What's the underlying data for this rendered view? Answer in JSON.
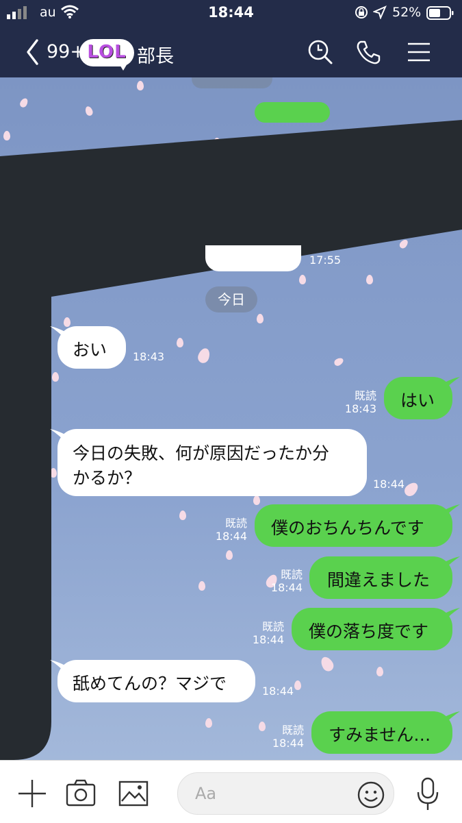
{
  "status_bar": {
    "carrier": "au",
    "time": "18:44",
    "battery": "52%"
  },
  "header": {
    "unread_count": "99+",
    "badge": "LOL",
    "title": "部長"
  },
  "chat": {
    "previous_time": "17:55",
    "date_separator": "今日",
    "messages": [
      {
        "side": "left",
        "text": "おい",
        "time": "18:43"
      },
      {
        "side": "right",
        "text": "はい",
        "read": "既読",
        "time": "18:43"
      },
      {
        "side": "left",
        "text_line1": "今日の失敗、何が原因だったか分",
        "text_line2": "かるか？",
        "time": "18:44"
      },
      {
        "side": "right",
        "text": "僕のおちんちんです",
        "read": "既読",
        "time": "18:44"
      },
      {
        "side": "right",
        "text": "間違えました",
        "read": "既読",
        "time": "18:44"
      },
      {
        "side": "right",
        "text": "僕の落ち度です",
        "read": "既読",
        "time": "18:44"
      },
      {
        "side": "left",
        "text": "舐めてんの？マジで",
        "time": "18:44"
      },
      {
        "side": "right",
        "text": "すみません…",
        "read": "既読",
        "time": "18:44"
      }
    ]
  },
  "input": {
    "placeholder": "Aa"
  },
  "colors": {
    "header_bg": "#232c49",
    "bubble_right": "#5ad14e",
    "bubble_left": "#ffffff",
    "redaction": "#262b30"
  },
  "icons": [
    "back-chevron-icon",
    "search-icon",
    "phone-icon",
    "menu-icon",
    "plus-icon",
    "camera-icon",
    "image-icon",
    "emoji-icon",
    "mic-icon"
  ]
}
